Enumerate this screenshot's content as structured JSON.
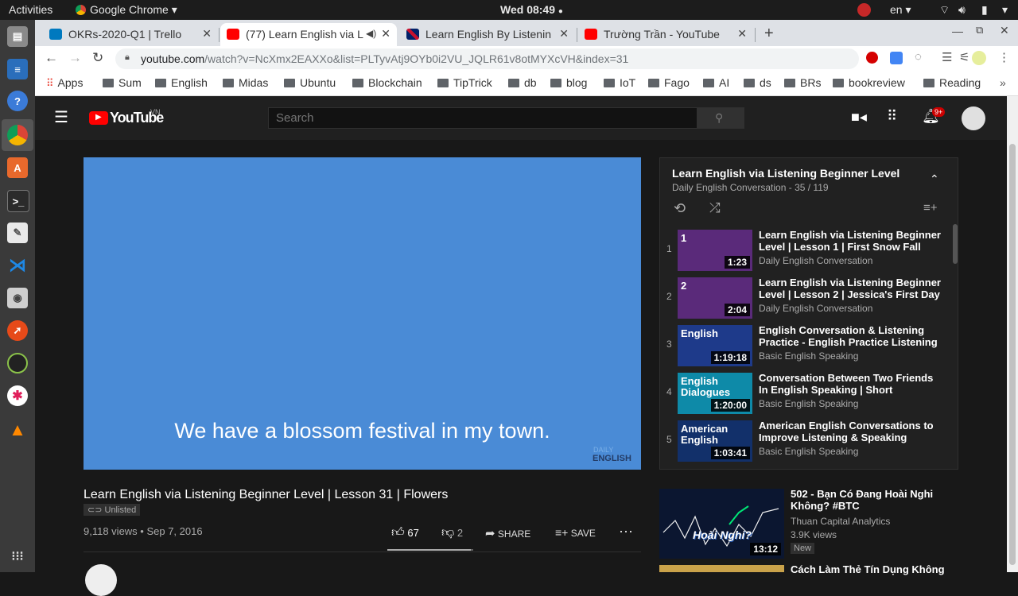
{
  "os": {
    "activities": "Activities",
    "app_menu": "Google Chrome",
    "clock": "Wed 08:49",
    "lang": "en"
  },
  "tabs": [
    {
      "title": "OKRs-2020-Q1 | Trello",
      "favicon": "trello-icon"
    },
    {
      "title": "(77) Learn English via L",
      "favicon": "youtube-icon"
    },
    {
      "title": "Learn English By Listenin",
      "favicon": "uk-flag-icon"
    },
    {
      "title": "Trường Trần - YouTube",
      "favicon": "youtube-icon"
    }
  ],
  "url": {
    "host": "youtube.com",
    "path": "/watch?v=NcXmx2EAXXo&list=PLTyvAtj9OYb0i2VU_JQLR61v8otMYXcVH&index=31"
  },
  "bookmarks": [
    "Apps",
    "Sum",
    "English",
    "Midas",
    "Ubuntu",
    "Blockchain",
    "TipTrick",
    "db",
    "blog",
    "IoT",
    "Fago",
    "AI",
    "ds",
    "BRs",
    "bookreview",
    "Reading"
  ],
  "youtube": {
    "logo": "YouTube",
    "region": "VN",
    "search_placeholder": "Search",
    "notification_badge": "9+",
    "player_caption": "We have a blossom festival in my town.",
    "watermark_top": "DAILY",
    "watermark_bottom": "ENGLISH",
    "video_title": "Learn English via Listening Beginner Level | Lesson 31 | Flowers",
    "unlisted": "Unlisted",
    "views_date": "9,118 views • Sep 7, 2016",
    "likes": "67",
    "dislikes": "2",
    "share": "SHARE",
    "save": "SAVE",
    "like_ratio": 0.97
  },
  "playlist": {
    "title": "Learn English via Listening Beginner Level",
    "subtitle": "Daily English Conversation - 35 / 119",
    "items": [
      {
        "num": "1",
        "title": "Learn English via Listening Beginner Level | Lesson 1 | First Snow Fall",
        "channel": "Daily English Conversation",
        "duration": "1:23",
        "thumb_text": "1",
        "thumb_color": "#5a2a7a"
      },
      {
        "num": "2",
        "title": "Learn English via Listening Beginner Level | Lesson 2 | Jessica's First Day ...",
        "channel": "Daily English Conversation",
        "duration": "2:04",
        "thumb_text": "2",
        "thumb_color": "#5a2a7a"
      },
      {
        "num": "3",
        "title": "English Conversation & Listening Practice - English Practice Listening t...",
        "channel": "Basic English Speaking",
        "duration": "1:19:18",
        "thumb_text": "English",
        "thumb_color": "#1e3a8a"
      },
      {
        "num": "4",
        "title": "Conversation Between Two Friends In English Speaking | Short Dialogues In...",
        "channel": "Basic English Speaking",
        "duration": "1:20:00",
        "thumb_text": "English Dialogues",
        "thumb_color": "#0e8aa8"
      },
      {
        "num": "5",
        "title": "American English Conversations to Improve Listening & Speaking Fluenc...",
        "channel": "Basic English Speaking",
        "duration": "1:03:41",
        "thumb_text": "American English",
        "thumb_color": "#12306a"
      }
    ]
  },
  "related": [
    {
      "title": "502 - Bạn Có Đang Hoài Nghi Không? #BTC",
      "channel": "Thuan Capital Analytics",
      "views": "3.9K views",
      "badge": "New",
      "duration": "13:12",
      "thumb_text": "Hoài Nghi?"
    },
    {
      "title": "Cách Làm Thẻ Tín Dụng Không",
      "channel": "",
      "views": "",
      "badge": "",
      "duration": "",
      "thumb_text": ""
    }
  ]
}
